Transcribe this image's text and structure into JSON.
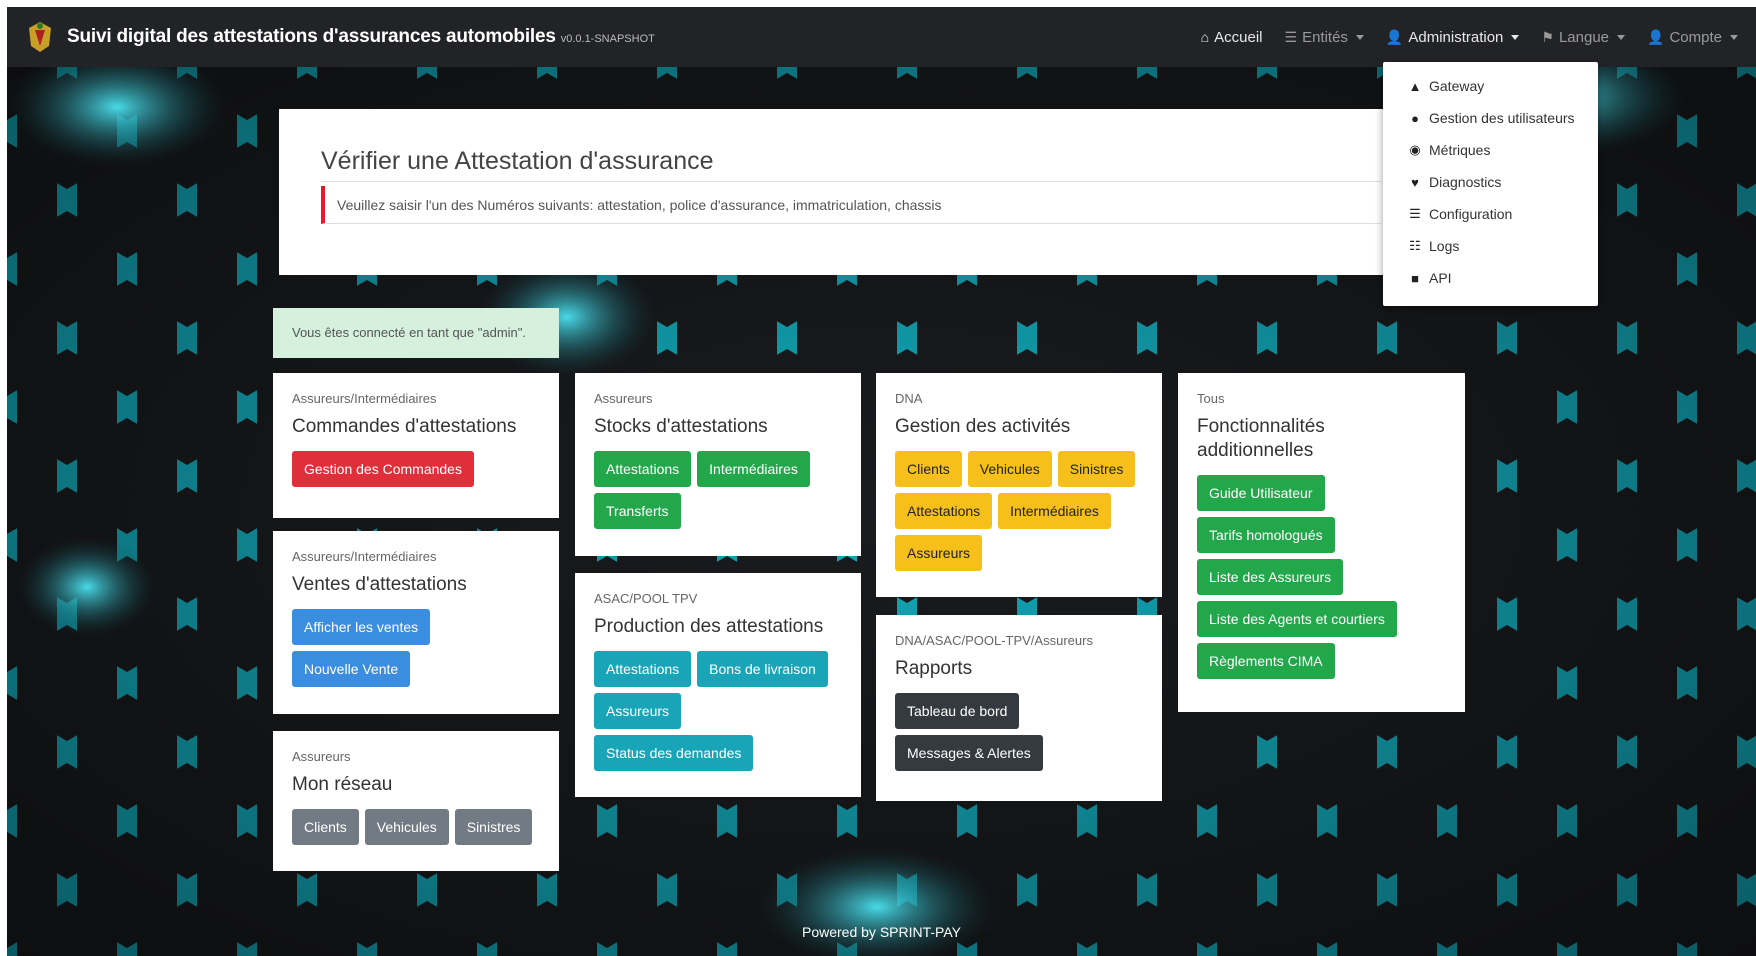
{
  "navbar": {
    "brand_title": "Suivi digital des attestations d'assurances automobiles",
    "brand_version": "v0.0.1-SNAPSHOT",
    "items": [
      {
        "label": "Accueil",
        "icon": "home-icon",
        "dim": false,
        "caret": false
      },
      {
        "label": "Entités",
        "icon": "list-icon",
        "dim": true,
        "caret": true
      },
      {
        "label": "Administration",
        "icon": "user-plus-icon",
        "dim": false,
        "caret": true
      },
      {
        "label": "Langue",
        "icon": "flag-icon",
        "dim": true,
        "caret": true
      },
      {
        "label": "Compte",
        "icon": "user-icon",
        "dim": true,
        "caret": true
      }
    ]
  },
  "admin_menu": [
    {
      "label": "Gateway",
      "icon": "road-icon"
    },
    {
      "label": "Gestion des utilisateurs",
      "icon": "user-icon"
    },
    {
      "label": "Métriques",
      "icon": "tachometer-icon"
    },
    {
      "label": "Diagnostics",
      "icon": "heart-icon"
    },
    {
      "label": "Configuration",
      "icon": "list-icon"
    },
    {
      "label": "Logs",
      "icon": "tasks-icon"
    },
    {
      "label": "API",
      "icon": "book-icon"
    }
  ],
  "verify": {
    "title": "Vérifier une Attestation d'assurance",
    "placeholder": "Veuillez saisir l'un des Numéros suivants: attestation, police d'assurance, immatriculation, chassis"
  },
  "alert": {
    "text": "Vous êtes connecté en tant que \"admin\"."
  },
  "cards": {
    "commandes": {
      "sub": "Assureurs/Intermédiaires",
      "title": "Commandes d'attestations",
      "buttons": [
        "Gestion des Commandes"
      ]
    },
    "ventes": {
      "sub": "Assureurs/Intermédiaires",
      "title": "Ventes d'attestations",
      "buttons": [
        "Afficher les ventes",
        "Nouvelle Vente"
      ]
    },
    "reseau": {
      "sub": "Assureurs",
      "title": "Mon réseau",
      "buttons": [
        "Clients",
        "Vehicules",
        "Sinistres"
      ]
    },
    "stocks": {
      "sub": "Assureurs",
      "title": "Stocks d'attestations",
      "buttons": [
        "Attestations",
        "Intermédiaires",
        "Transferts"
      ]
    },
    "production": {
      "sub": "ASAC/POOL TPV",
      "title": "Production des attestations",
      "buttons": [
        "Attestations",
        "Bons de livraison",
        "Assureurs",
        "Status des demandes"
      ]
    },
    "activites": {
      "sub": "DNA",
      "title": "Gestion des activités",
      "buttons": [
        "Clients",
        "Vehicules",
        "Sinistres",
        "Attestations",
        "Intermédiaires",
        "Assureurs"
      ]
    },
    "rapports": {
      "sub": "DNA/ASAC/POOL-TPV/Assureurs",
      "title": "Rapports",
      "buttons": [
        "Tableau de bord",
        "Messages & Alertes"
      ]
    },
    "fonctionnalites": {
      "sub": "Tous",
      "title": "Fonctionnalités additionnelles",
      "buttons": [
        "Guide Utilisateur",
        "Tarifs homologués",
        "Liste des Assureurs",
        "Liste des Agents et courtiers",
        "Règlements CIMA"
      ]
    }
  },
  "footer": {
    "text": "Powered by SPRINT-PAY"
  },
  "colors": {
    "navbar": "#222326",
    "danger": "#e02f3a",
    "success": "#22a74a",
    "info": "#19a5b8",
    "warning": "#f7bf1a",
    "primary": "#3b8de0",
    "secondary": "#727b84",
    "dark": "#353a40",
    "glow": "#1fd6e8"
  }
}
